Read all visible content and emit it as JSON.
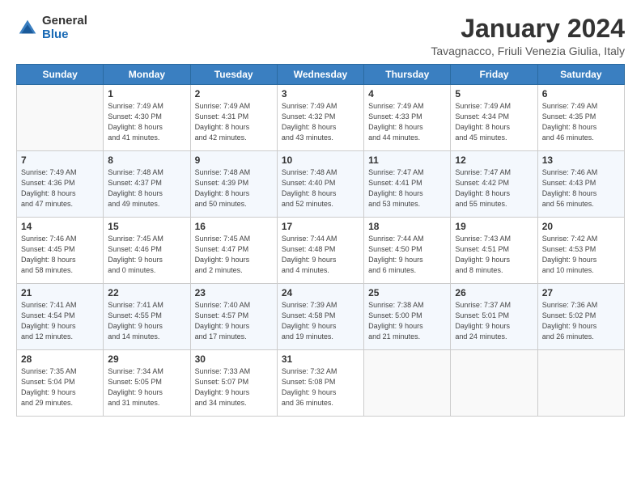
{
  "logo": {
    "general": "General",
    "blue": "Blue"
  },
  "title": "January 2024",
  "subtitle": "Tavagnacco, Friuli Venezia Giulia, Italy",
  "days_of_week": [
    "Sunday",
    "Monday",
    "Tuesday",
    "Wednesday",
    "Thursday",
    "Friday",
    "Saturday"
  ],
  "weeks": [
    [
      {
        "day": "",
        "info": ""
      },
      {
        "day": "1",
        "info": "Sunrise: 7:49 AM\nSunset: 4:30 PM\nDaylight: 8 hours\nand 41 minutes."
      },
      {
        "day": "2",
        "info": "Sunrise: 7:49 AM\nSunset: 4:31 PM\nDaylight: 8 hours\nand 42 minutes."
      },
      {
        "day": "3",
        "info": "Sunrise: 7:49 AM\nSunset: 4:32 PM\nDaylight: 8 hours\nand 43 minutes."
      },
      {
        "day": "4",
        "info": "Sunrise: 7:49 AM\nSunset: 4:33 PM\nDaylight: 8 hours\nand 44 minutes."
      },
      {
        "day": "5",
        "info": "Sunrise: 7:49 AM\nSunset: 4:34 PM\nDaylight: 8 hours\nand 45 minutes."
      },
      {
        "day": "6",
        "info": "Sunrise: 7:49 AM\nSunset: 4:35 PM\nDaylight: 8 hours\nand 46 minutes."
      }
    ],
    [
      {
        "day": "7",
        "info": "Sunrise: 7:49 AM\nSunset: 4:36 PM\nDaylight: 8 hours\nand 47 minutes."
      },
      {
        "day": "8",
        "info": "Sunrise: 7:48 AM\nSunset: 4:37 PM\nDaylight: 8 hours\nand 49 minutes."
      },
      {
        "day": "9",
        "info": "Sunrise: 7:48 AM\nSunset: 4:39 PM\nDaylight: 8 hours\nand 50 minutes."
      },
      {
        "day": "10",
        "info": "Sunrise: 7:48 AM\nSunset: 4:40 PM\nDaylight: 8 hours\nand 52 minutes."
      },
      {
        "day": "11",
        "info": "Sunrise: 7:47 AM\nSunset: 4:41 PM\nDaylight: 8 hours\nand 53 minutes."
      },
      {
        "day": "12",
        "info": "Sunrise: 7:47 AM\nSunset: 4:42 PM\nDaylight: 8 hours\nand 55 minutes."
      },
      {
        "day": "13",
        "info": "Sunrise: 7:46 AM\nSunset: 4:43 PM\nDaylight: 8 hours\nand 56 minutes."
      }
    ],
    [
      {
        "day": "14",
        "info": "Sunrise: 7:46 AM\nSunset: 4:45 PM\nDaylight: 8 hours\nand 58 minutes."
      },
      {
        "day": "15",
        "info": "Sunrise: 7:45 AM\nSunset: 4:46 PM\nDaylight: 9 hours\nand 0 minutes."
      },
      {
        "day": "16",
        "info": "Sunrise: 7:45 AM\nSunset: 4:47 PM\nDaylight: 9 hours\nand 2 minutes."
      },
      {
        "day": "17",
        "info": "Sunrise: 7:44 AM\nSunset: 4:48 PM\nDaylight: 9 hours\nand 4 minutes."
      },
      {
        "day": "18",
        "info": "Sunrise: 7:44 AM\nSunset: 4:50 PM\nDaylight: 9 hours\nand 6 minutes."
      },
      {
        "day": "19",
        "info": "Sunrise: 7:43 AM\nSunset: 4:51 PM\nDaylight: 9 hours\nand 8 minutes."
      },
      {
        "day": "20",
        "info": "Sunrise: 7:42 AM\nSunset: 4:53 PM\nDaylight: 9 hours\nand 10 minutes."
      }
    ],
    [
      {
        "day": "21",
        "info": "Sunrise: 7:41 AM\nSunset: 4:54 PM\nDaylight: 9 hours\nand 12 minutes."
      },
      {
        "day": "22",
        "info": "Sunrise: 7:41 AM\nSunset: 4:55 PM\nDaylight: 9 hours\nand 14 minutes."
      },
      {
        "day": "23",
        "info": "Sunrise: 7:40 AM\nSunset: 4:57 PM\nDaylight: 9 hours\nand 17 minutes."
      },
      {
        "day": "24",
        "info": "Sunrise: 7:39 AM\nSunset: 4:58 PM\nDaylight: 9 hours\nand 19 minutes."
      },
      {
        "day": "25",
        "info": "Sunrise: 7:38 AM\nSunset: 5:00 PM\nDaylight: 9 hours\nand 21 minutes."
      },
      {
        "day": "26",
        "info": "Sunrise: 7:37 AM\nSunset: 5:01 PM\nDaylight: 9 hours\nand 24 minutes."
      },
      {
        "day": "27",
        "info": "Sunrise: 7:36 AM\nSunset: 5:02 PM\nDaylight: 9 hours\nand 26 minutes."
      }
    ],
    [
      {
        "day": "28",
        "info": "Sunrise: 7:35 AM\nSunset: 5:04 PM\nDaylight: 9 hours\nand 29 minutes."
      },
      {
        "day": "29",
        "info": "Sunrise: 7:34 AM\nSunset: 5:05 PM\nDaylight: 9 hours\nand 31 minutes."
      },
      {
        "day": "30",
        "info": "Sunrise: 7:33 AM\nSunset: 5:07 PM\nDaylight: 9 hours\nand 34 minutes."
      },
      {
        "day": "31",
        "info": "Sunrise: 7:32 AM\nSunset: 5:08 PM\nDaylight: 9 hours\nand 36 minutes."
      },
      {
        "day": "",
        "info": ""
      },
      {
        "day": "",
        "info": ""
      },
      {
        "day": "",
        "info": ""
      }
    ]
  ]
}
